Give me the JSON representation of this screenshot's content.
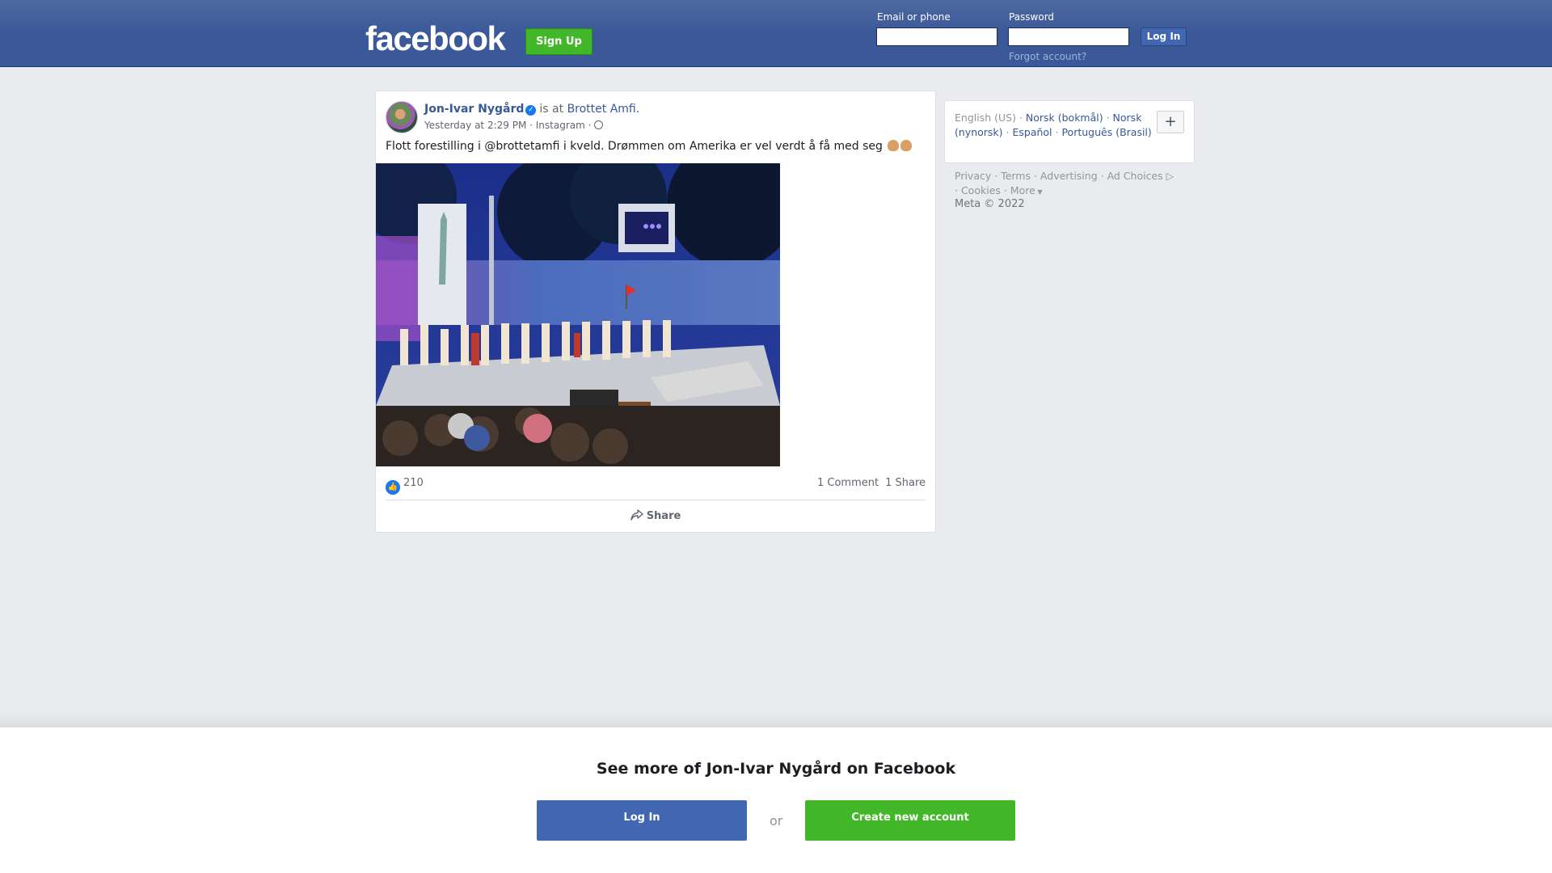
{
  "header": {
    "logo": "facebook",
    "signup_label": "Sign Up",
    "email_label": "Email or phone",
    "password_label": "Password",
    "login_label": "Log In",
    "forgot_label": "Forgot account?"
  },
  "post": {
    "author": "Jon-Ivar Nygård",
    "is_at": "is at",
    "place": "Brottet Amfi.",
    "timestamp": "Yesterday at 2:29 PM",
    "source": "Instagram",
    "text": "Flott forestilling i @brottetamfi i kveld. Drømmen om Amerika er vel verdt å få med seg",
    "likes": "210",
    "comments": "1 Comment",
    "shares": "1 Share",
    "share_label": "Share"
  },
  "sidebar": {
    "current_language": "English (US)",
    "languages": [
      "Norsk (bokmål)",
      "Norsk (nynorsk)",
      "Español",
      "Português (Brasil)"
    ],
    "plus_label": "+",
    "footer_links": [
      "Privacy",
      "Terms",
      "Advertising",
      "Ad Choices",
      "Cookies",
      "More"
    ],
    "copyright": "Meta © 2022"
  },
  "bottom": {
    "see_more": "See more of Jon-Ivar Nygård on Facebook",
    "login_label": "Log In",
    "or_label": "or",
    "create_label": "Create new account"
  },
  "colors": {
    "brand_blue": "#3b5998",
    "green": "#42b72a",
    "link": "#385898"
  }
}
